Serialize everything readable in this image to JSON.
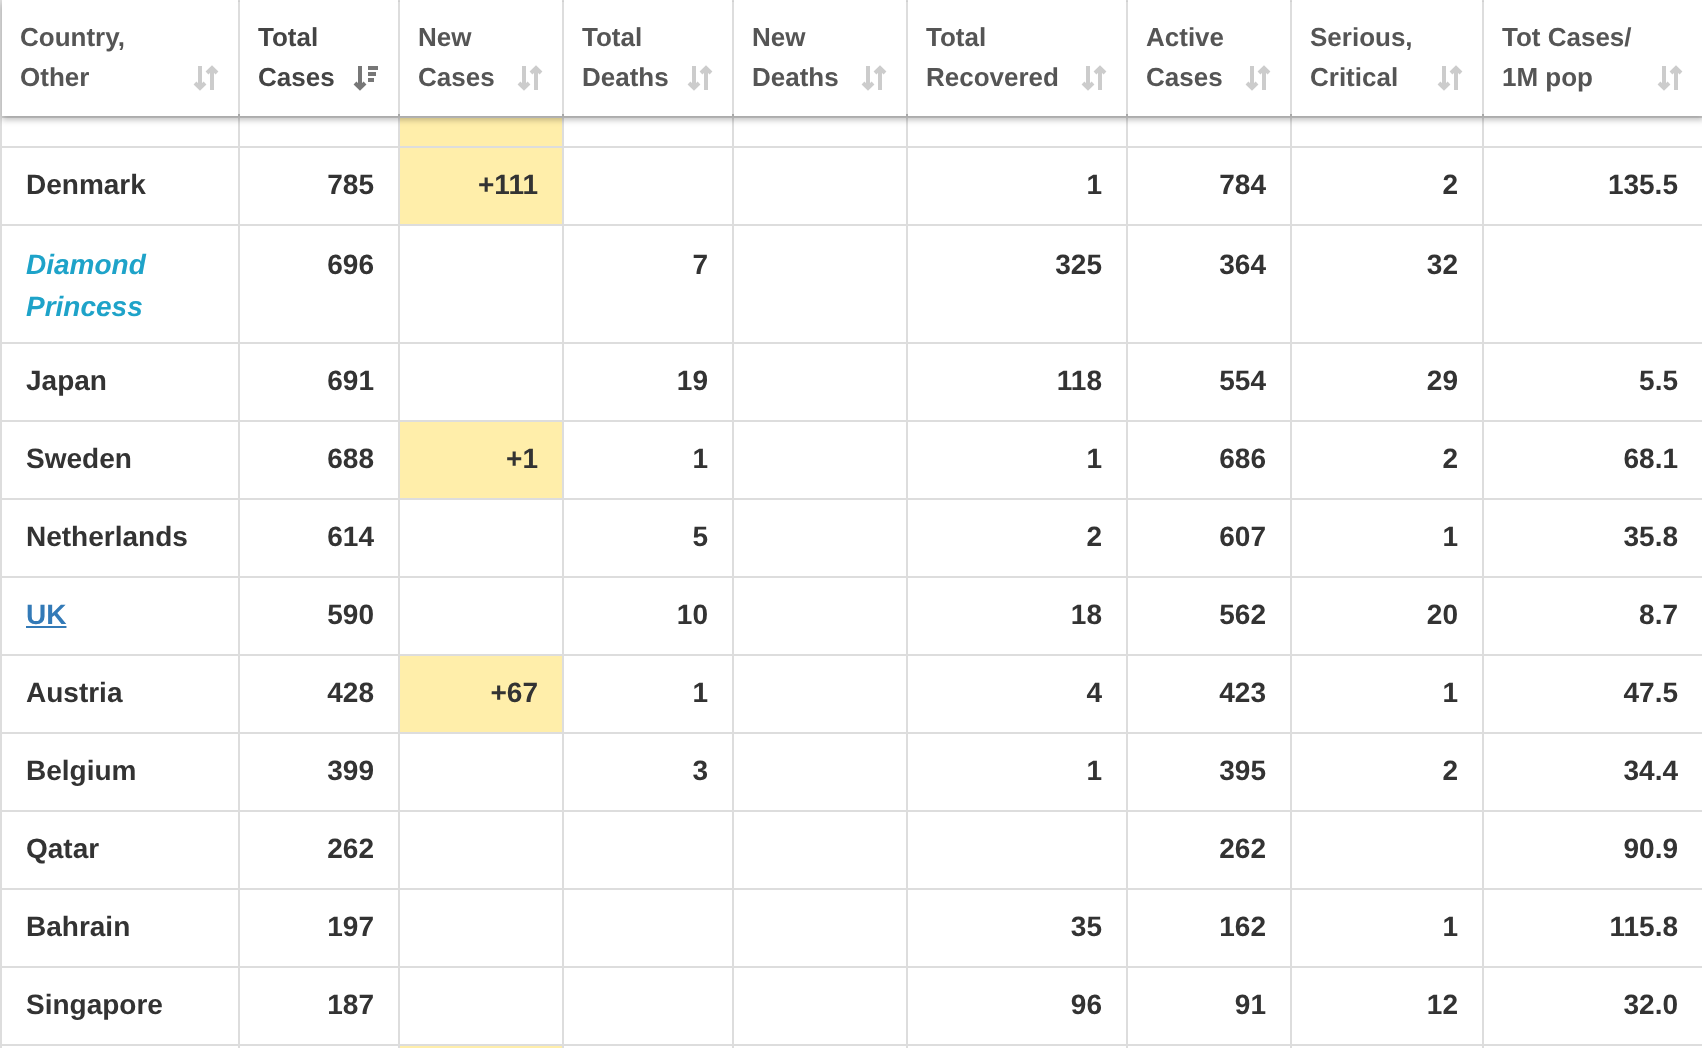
{
  "table": {
    "columns": [
      {
        "line_1": "Country,",
        "line_2": "Other",
        "sorted": false
      },
      {
        "line_1": "Total",
        "line_2": "Cases",
        "sorted": true
      },
      {
        "line_1": "New",
        "line_2": "Cases",
        "sorted": false
      },
      {
        "line_1": "Total",
        "line_2": "Deaths",
        "sorted": false
      },
      {
        "line_1": "New",
        "line_2": "Deaths",
        "sorted": false
      },
      {
        "line_1": "Total",
        "line_2": "Recovered",
        "sorted": false
      },
      {
        "line_1": "Active",
        "line_2": "Cases",
        "sorted": false
      },
      {
        "line_1": "Serious,",
        "line_2": "Critical",
        "sorted": false
      },
      {
        "line_1": "Tot Cases/",
        "line_2": "1M pop",
        "sorted": false
      }
    ],
    "rows": [
      {
        "kind": "partial",
        "new_cases_highlighted": true,
        "cells": []
      },
      {
        "kind": "plain",
        "new_cases_highlighted": true,
        "cells": [
          "Denmark",
          "785",
          "+111",
          "",
          "",
          "1",
          "784",
          "2",
          "135.5"
        ]
      },
      {
        "kind": "italic",
        "new_cases_highlighted": false,
        "cells": [
          "Diamond Princess",
          "696",
          "",
          "7",
          "",
          "325",
          "364",
          "32",
          ""
        ]
      },
      {
        "kind": "plain",
        "new_cases_highlighted": false,
        "cells": [
          "Japan",
          "691",
          "",
          "19",
          "",
          "118",
          "554",
          "29",
          "5.5"
        ]
      },
      {
        "kind": "plain",
        "new_cases_highlighted": true,
        "cells": [
          "Sweden",
          "688",
          "+1",
          "1",
          "",
          "1",
          "686",
          "2",
          "68.1"
        ]
      },
      {
        "kind": "plain",
        "new_cases_highlighted": false,
        "cells": [
          "Netherlands",
          "614",
          "",
          "5",
          "",
          "2",
          "607",
          "1",
          "35.8"
        ]
      },
      {
        "kind": "link",
        "new_cases_highlighted": false,
        "cells": [
          "UK",
          "590",
          "",
          "10",
          "",
          "18",
          "562",
          "20",
          "8.7"
        ]
      },
      {
        "kind": "plain",
        "new_cases_highlighted": true,
        "cells": [
          "Austria",
          "428",
          "+67",
          "1",
          "",
          "4",
          "423",
          "1",
          "47.5"
        ]
      },
      {
        "kind": "plain",
        "new_cases_highlighted": false,
        "cells": [
          "Belgium",
          "399",
          "",
          "3",
          "",
          "1",
          "395",
          "2",
          "34.4"
        ]
      },
      {
        "kind": "plain",
        "new_cases_highlighted": false,
        "cells": [
          "Qatar",
          "262",
          "",
          "",
          "",
          "",
          "262",
          "",
          "90.9"
        ]
      },
      {
        "kind": "plain",
        "new_cases_highlighted": false,
        "cells": [
          "Bahrain",
          "197",
          "",
          "",
          "",
          "35",
          "162",
          "1",
          "115.8"
        ]
      },
      {
        "kind": "plain",
        "new_cases_highlighted": false,
        "cells": [
          "Singapore",
          "187",
          "",
          "",
          "",
          "96",
          "91",
          "12",
          "32.0"
        ]
      },
      {
        "kind": "partial",
        "new_cases_highlighted": true,
        "cells": []
      }
    ]
  }
}
